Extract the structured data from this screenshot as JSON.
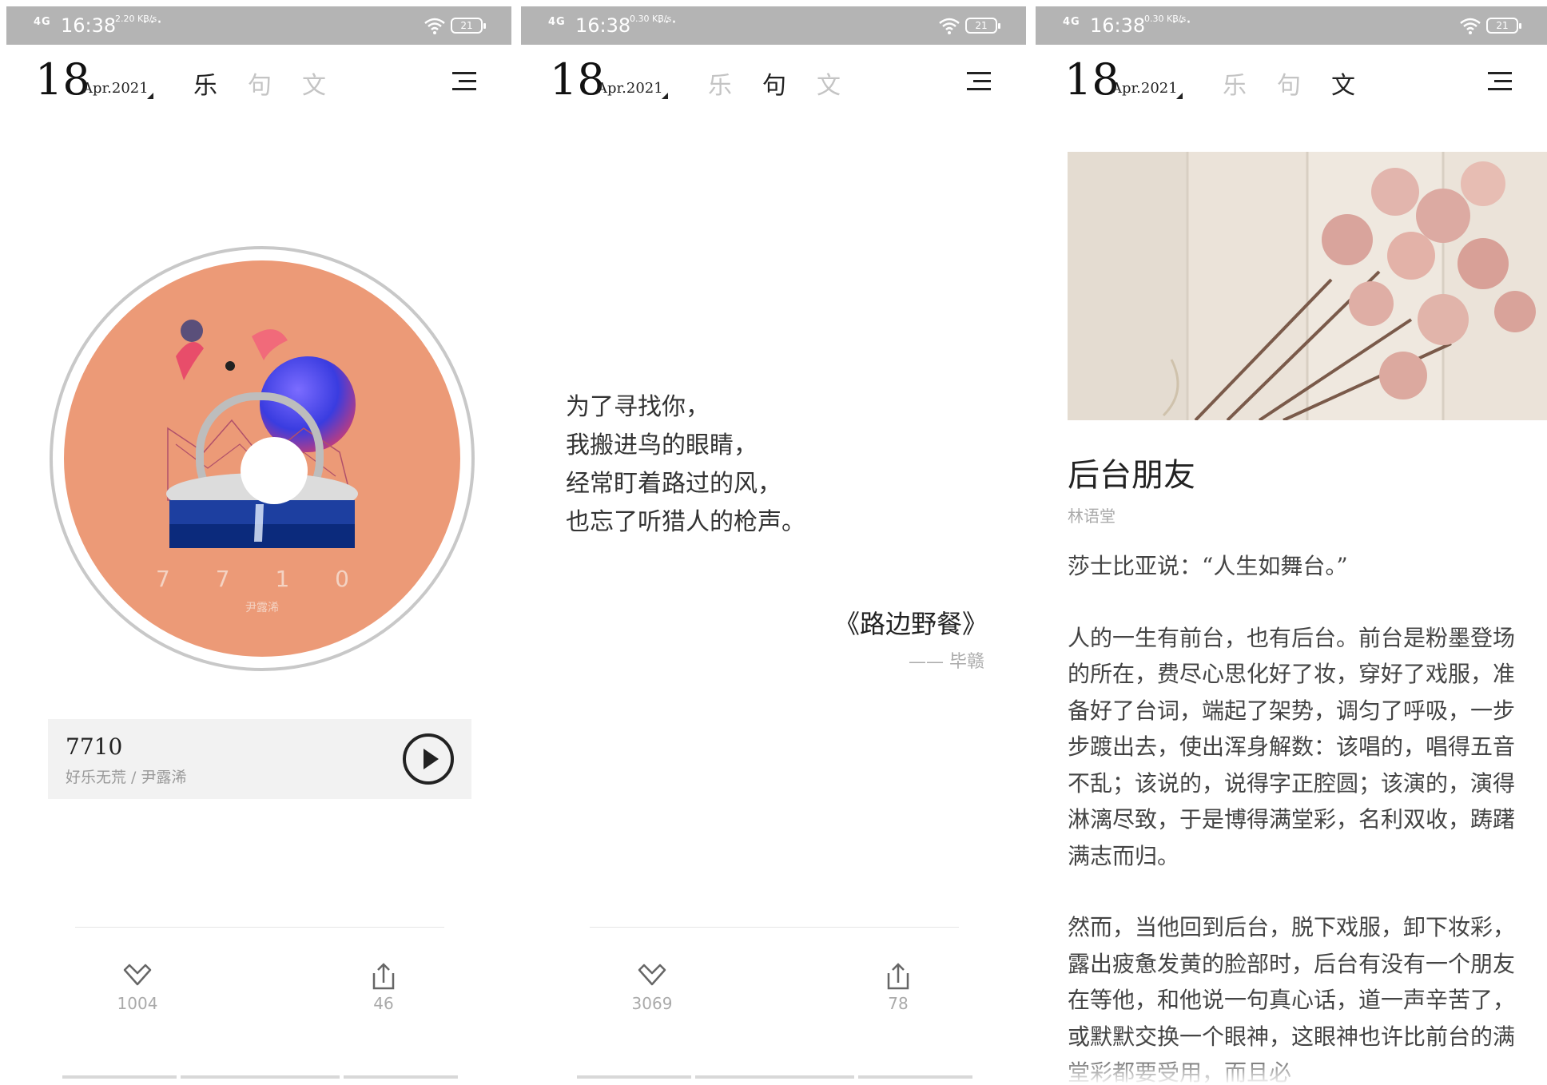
{
  "status": {
    "time": "16:38",
    "signal": "4G",
    "battery": "21",
    "more": "···"
  },
  "panels": [
    {
      "status_speed": "2.20 KB/s",
      "date": {
        "day": "18",
        "month": "Apr.2021"
      },
      "tabs": [
        "乐",
        "句",
        "文"
      ],
      "active_tab": 0
    },
    {
      "status_speed": "0.30 KB/s",
      "date": {
        "day": "18",
        "month": "Apr.2021"
      },
      "tabs": [
        "乐",
        "句",
        "文"
      ],
      "active_tab": 1
    },
    {
      "status_speed": "0.30 KB/s",
      "date": {
        "day": "18",
        "month": "Apr.2021"
      },
      "tabs": [
        "乐",
        "句",
        "文"
      ],
      "active_tab": 2
    }
  ],
  "music": {
    "cover_title": "7 7 1 0",
    "cover_artist": "尹露浠",
    "track_title": "7710",
    "track_subtitle": "好乐无荒 / 尹露浠",
    "likes": "1004",
    "shares": "46"
  },
  "quote": {
    "lines": [
      "为了寻找你，",
      "我搬进鸟的眼睛，",
      "经常盯着路过的风，",
      "也忘了听猎人的枪声。"
    ],
    "source": "《路边野餐》",
    "author": "—— 毕赣",
    "likes": "3069",
    "shares": "78"
  },
  "article": {
    "title": "后台朋友",
    "author": "林语堂",
    "paragraphs": [
      "莎士比亚说：“人生如舞台。”",
      "人的一生有前台，也有后台。前台是粉墨登场的所在，费尽心思化好了妆，穿好了戏服，准备好了台词，端起了架势，调匀了呼吸，一步步踱出去，使出浑身解数：该唱的，唱得五音不乱；该说的，说得字正腔圆；该演的，演得淋漓尽致，于是博得满堂彩，名利双收，踌躇满志而归。",
      "然而，当他回到后台，脱下戏服，卸下妆彩，露出疲惫发黄的脸部时，后台有没有一个朋友在等他，和他说一句真心话，道一声辛苦了，或默默交换一个眼神，这眼神也许比前台的满堂彩都要受用，而且必"
    ]
  },
  "colors": {
    "status_bar": "#b4b4b4",
    "disc_fill": "#ec9a77",
    "active_tab": "#222222",
    "inactive_tab": "#c4c4c4"
  }
}
